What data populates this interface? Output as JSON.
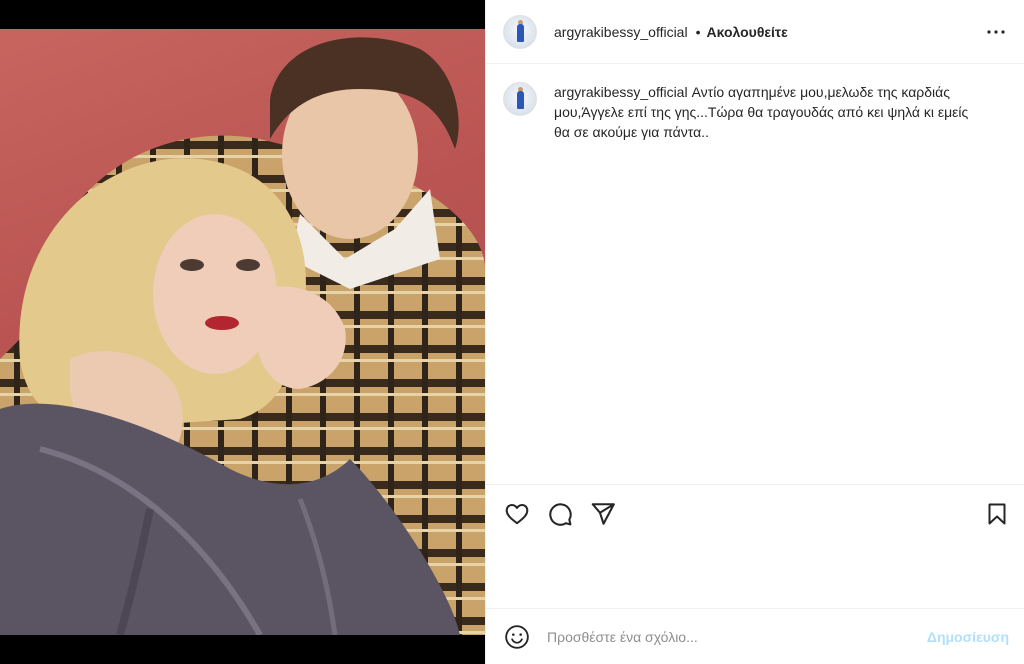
{
  "post": {
    "username": "argyrakibessy_official",
    "separator": "•",
    "follow_label": "Ακολουθείτε",
    "caption_text": "Αντίο αγαπημένε μου,μελωδε της καρδιάς μου,Άγγελε επί της γης...Τώρα θα τραγουδάς από κει ψηλά κι εμείς θα σε ακούμε για πάντα..",
    "icons": {
      "more": "more-options-icon",
      "like": "heart-icon",
      "comment": "comment-icon",
      "share": "paper-plane-icon",
      "save": "bookmark-icon",
      "emoji": "smiley-icon"
    }
  },
  "comment_box": {
    "placeholder": "Προσθέστε ένα σχόλιο...",
    "post_label": "Δημοσίευση"
  },
  "colors": {
    "text": "#262626",
    "muted": "#8e8e8e",
    "post_disabled": "#b2dffc",
    "divider": "#efefef",
    "photo_bg": "#b95452"
  }
}
